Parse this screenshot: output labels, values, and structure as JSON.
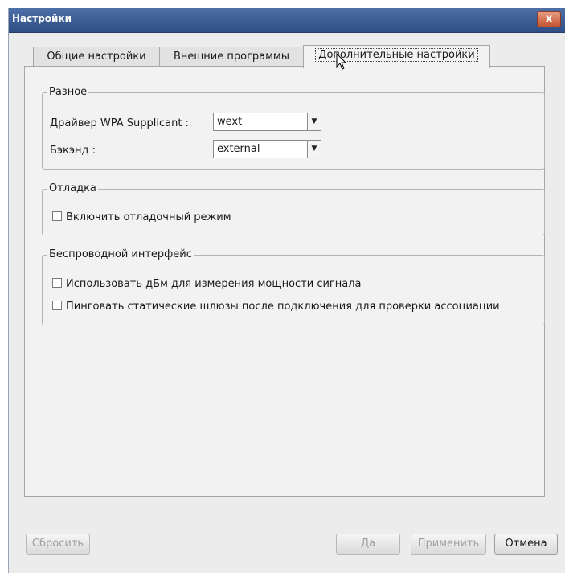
{
  "window": {
    "title": "Настройки",
    "close_glyph": "x"
  },
  "tabs": [
    {
      "label": "Общие настройки",
      "active": false
    },
    {
      "label": "Внешние программы",
      "active": false
    },
    {
      "label": "Дополнительные настройки",
      "active": true
    }
  ],
  "groups": {
    "misc": {
      "title": "Разное",
      "driver_label": "Драйвер WPA Supplicant :",
      "driver_value": "wext",
      "backend_label": "Бэкэнд :",
      "backend_value": "external"
    },
    "debug": {
      "title": "Отладка",
      "debug_checkbox": {
        "label": "Включить отладочный режим",
        "checked": false
      }
    },
    "wireless": {
      "title": "Беспроводной интерфейс",
      "dbm_checkbox": {
        "label": "Использовать дБм для измерения мощности сигнала",
        "checked": false
      },
      "ping_checkbox": {
        "label": "Пинговать статические шлюзы после подключения для проверки ассоциации",
        "checked": false
      }
    }
  },
  "buttons": {
    "reset": {
      "label": "Сбросить",
      "enabled": false
    },
    "ok": {
      "label": "Да",
      "enabled": false
    },
    "apply": {
      "label": "Применить",
      "enabled": false
    },
    "cancel": {
      "label": "Отмена",
      "enabled": true
    }
  },
  "icons": {
    "dropdown_arrow": "chevron-down-icon",
    "close": "close-icon",
    "cursor": "mouse-pointer-icon"
  }
}
